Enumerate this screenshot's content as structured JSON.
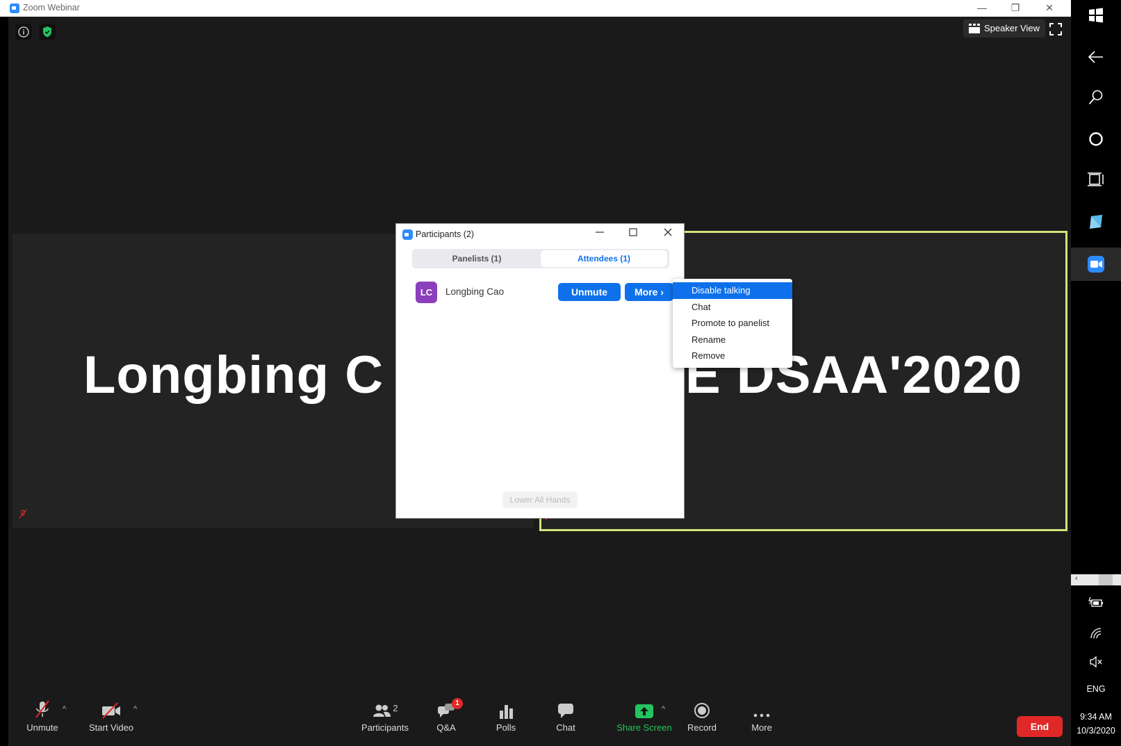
{
  "window": {
    "title": "Zoom Webinar",
    "controls": {
      "minimize": "—",
      "restore": "❐",
      "close": "✕"
    }
  },
  "top_bar": {
    "speaker_view_label": "Speaker View"
  },
  "shared_content": {
    "text_left": "Longbing C",
    "text_right": "E DSAA'2020"
  },
  "participants_panel": {
    "title": "Participants (2)",
    "tabs": [
      {
        "label": "Panelists (1)",
        "selected": false
      },
      {
        "label": "Attendees (1)",
        "selected": true
      }
    ],
    "attendee": {
      "initials": "LC",
      "name": "Longbing Cao",
      "avatar_color": "#8a3fbd"
    },
    "unmute_label": "Unmute",
    "more_label": "More ›",
    "lower_all_hands_label": "Lower All Hands"
  },
  "context_menu": {
    "items": [
      {
        "label": "Disable talking",
        "highlighted": true
      },
      {
        "label": "Chat",
        "highlighted": false
      },
      {
        "label": "Promote to panelist",
        "highlighted": false
      },
      {
        "label": "Rename",
        "highlighted": false
      },
      {
        "label": "Remove",
        "highlighted": false
      }
    ]
  },
  "toolbar": {
    "unmute": "Unmute",
    "start_video": "Start Video",
    "participants": "Participants",
    "participants_count": "2",
    "qa": "Q&A",
    "qa_badge": "1",
    "polls": "Polls",
    "chat": "Chat",
    "share_screen": "Share Screen",
    "record": "Record",
    "more": "More",
    "end": "End"
  },
  "system_tray": {
    "language": "ENG",
    "time": "9:34 AM",
    "date": "10/3/2020"
  },
  "colors": {
    "accent": "#0e71eb",
    "end_red": "#e02828",
    "share_green": "#22c55e",
    "active_speaker_border": "#d4e47a"
  }
}
